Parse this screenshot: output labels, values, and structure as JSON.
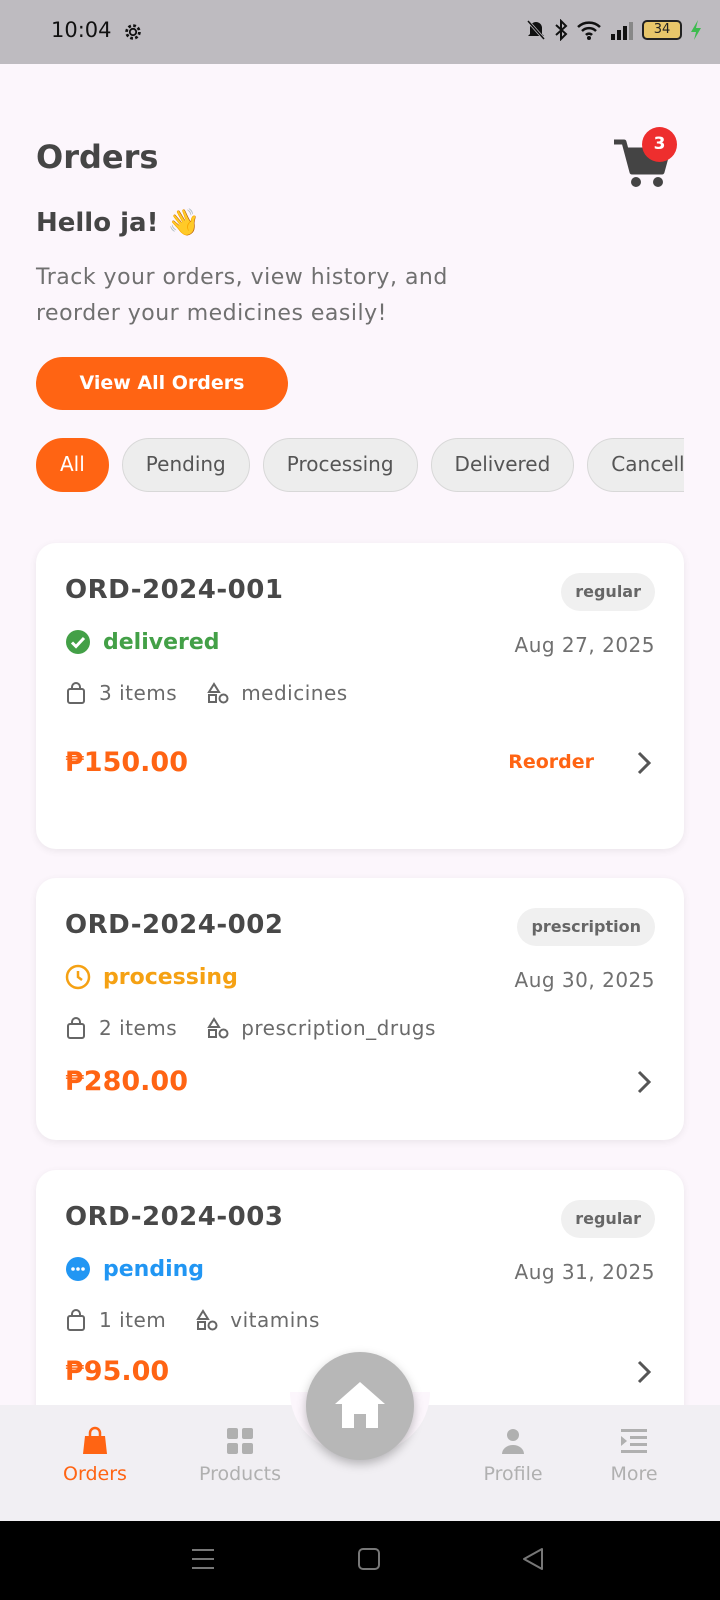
{
  "status_bar": {
    "time": "10:04",
    "battery": "34"
  },
  "header": {
    "title": "Orders",
    "cart_count": "3",
    "greeting": "Hello ja! 👋",
    "subtitle": "Track your orders, view history, and reorder your medicines easily!",
    "view_all_label": "View All Orders"
  },
  "filters": [
    "All",
    "Pending",
    "Processing",
    "Delivered",
    "Cancelled"
  ],
  "orders": [
    {
      "id": "ORD-2024-001",
      "type": "regular",
      "status": "delivered",
      "status_color": "#43a047",
      "date": "Aug 27, 2025",
      "items": "3 items",
      "category": "medicines",
      "total": "₱150.00",
      "action": "Reorder"
    },
    {
      "id": "ORD-2024-002",
      "type": "prescription",
      "status": "processing",
      "status_color": "#f5a113",
      "date": "Aug 30, 2025",
      "items": "2 items",
      "category": "prescription_drugs",
      "total": "₱280.00"
    },
    {
      "id": "ORD-2024-003",
      "type": "regular",
      "status": "pending",
      "status_color": "#2196f3",
      "date": "Aug 31, 2025",
      "items": "1 item",
      "category": "vitamins",
      "total": "₱95.00"
    }
  ],
  "bottom_nav": {
    "orders": "Orders",
    "products": "Products",
    "profile": "Profile",
    "more": "More"
  },
  "colors": {
    "accent": "#ff6413",
    "badge": "#ee2e2e"
  }
}
